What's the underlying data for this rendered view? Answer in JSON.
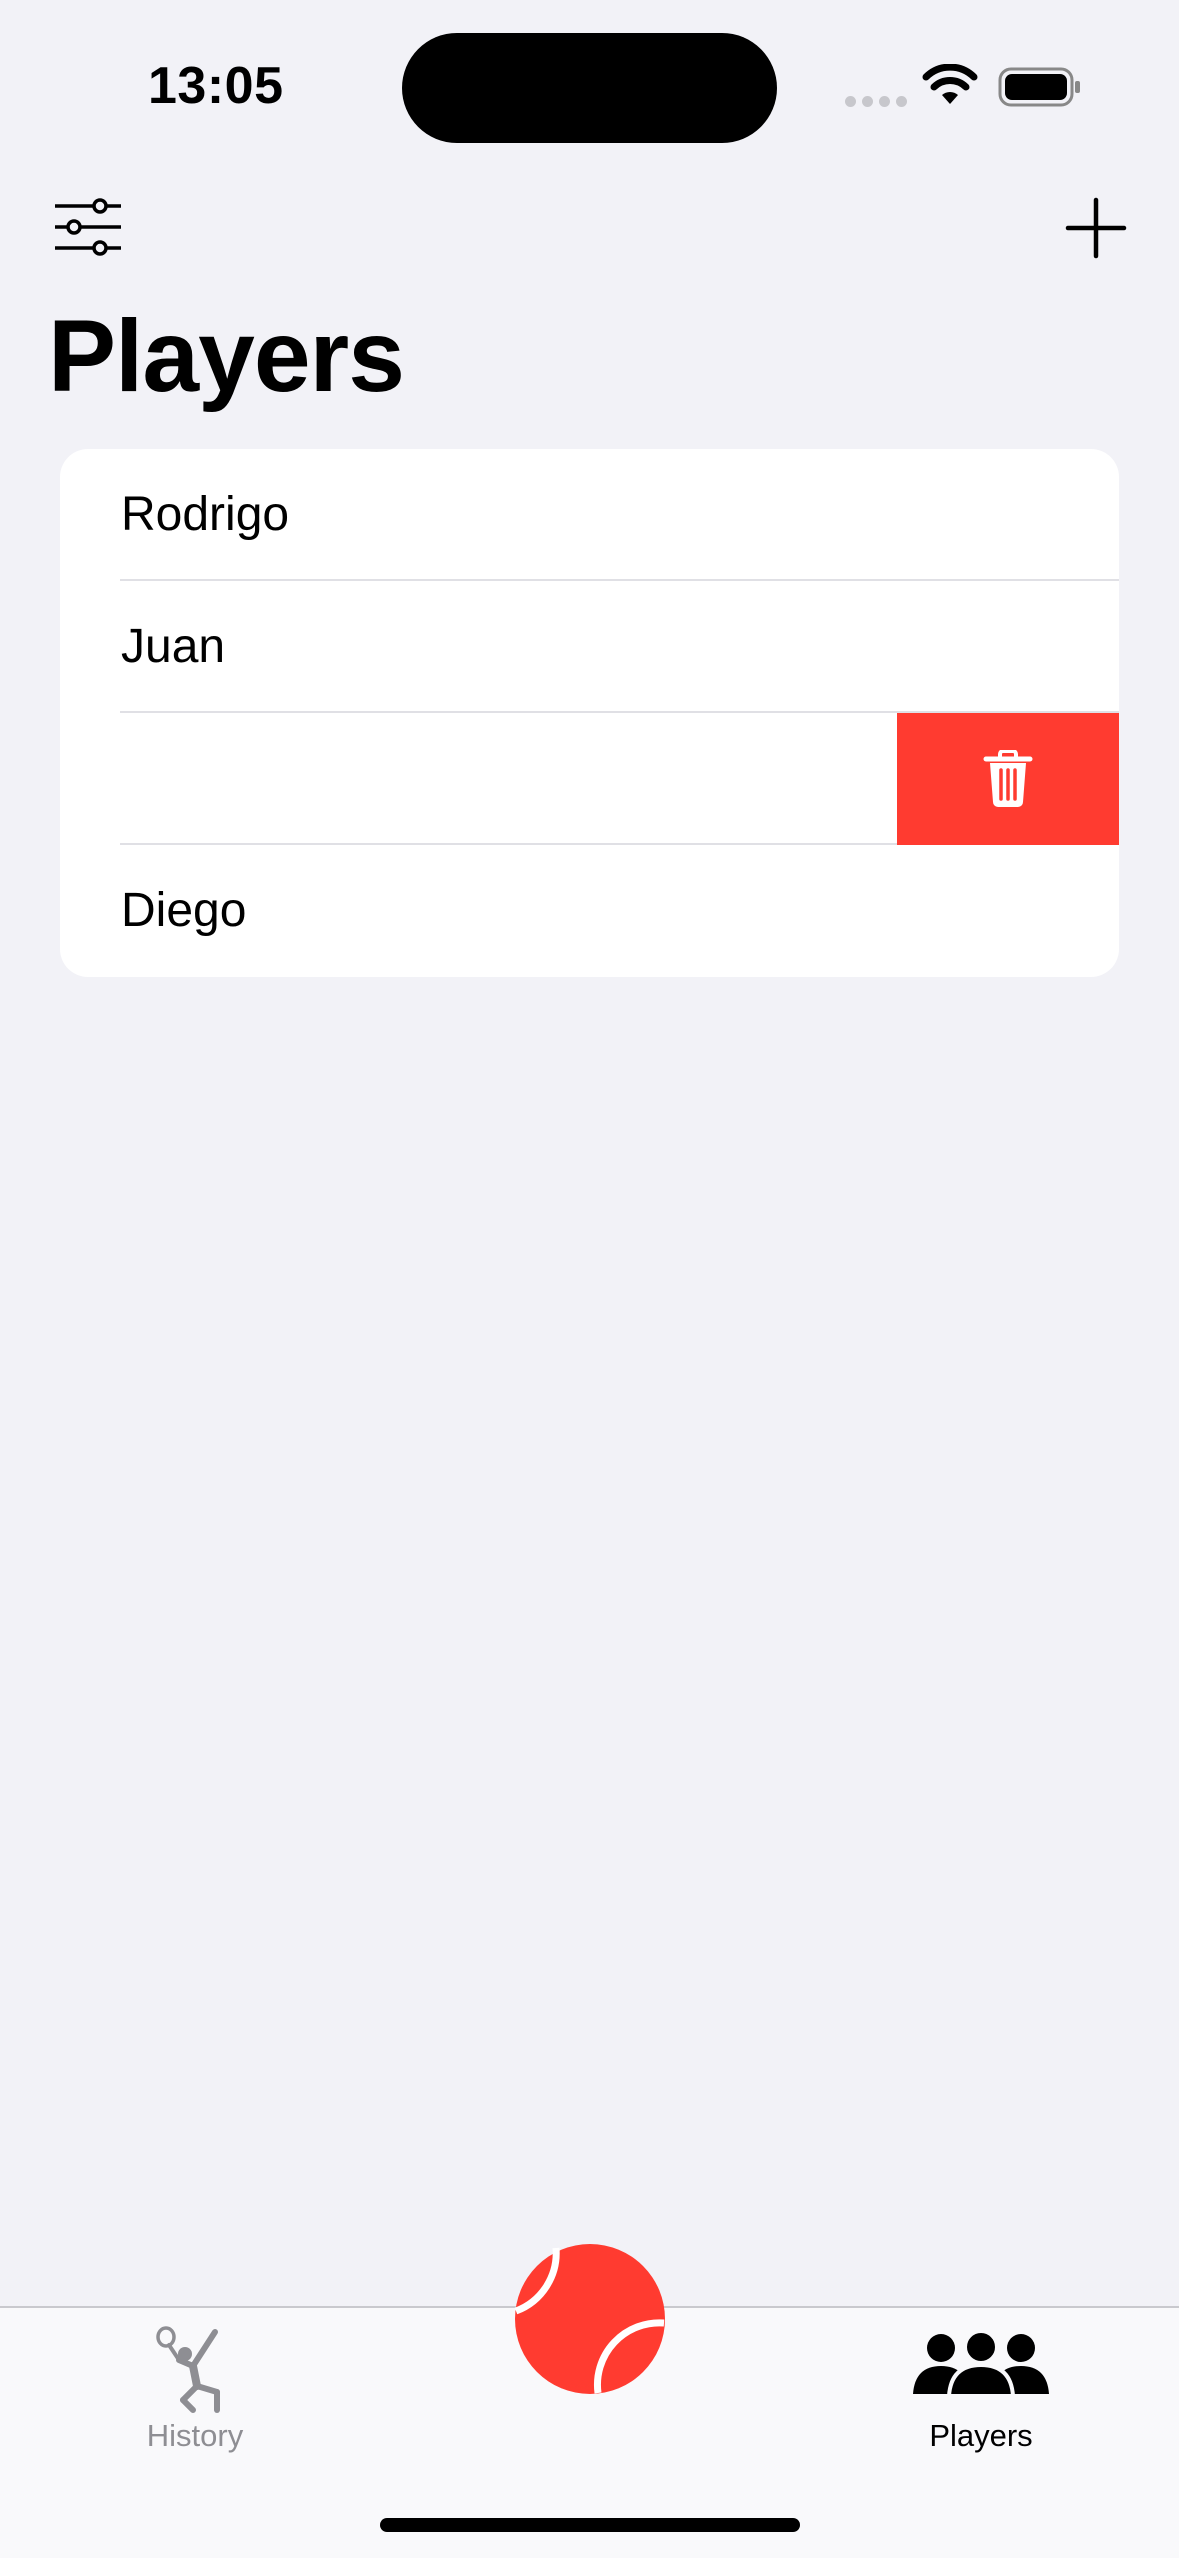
{
  "status_bar": {
    "time": "13:05"
  },
  "nav": {
    "filter_icon": "sliders-icon",
    "add_icon": "plus-icon"
  },
  "page": {
    "title": "Players"
  },
  "players": [
    {
      "name": "Rodrigo"
    },
    {
      "name": "Juan"
    },
    {
      "name": ""
    },
    {
      "name": "Diego"
    }
  ],
  "swipe_action": {
    "icon": "trash-icon",
    "color": "#ff3b30"
  },
  "tab_bar": {
    "tabs": [
      {
        "label": "History",
        "icon": "tennis-player-icon",
        "selected": false
      },
      {
        "label": "Players",
        "icon": "people-group-icon",
        "selected": true
      }
    ],
    "center_button_icon": "tennis-ball-icon"
  },
  "colors": {
    "accent": "#ff3b30",
    "background": "#f2f2f7",
    "inactive_tab": "#8e8e93"
  }
}
